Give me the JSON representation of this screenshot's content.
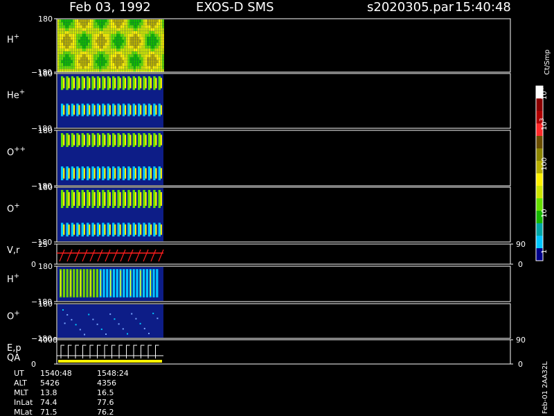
{
  "header": {
    "date": "Feb 03, 1992",
    "instrument": "EXOS-D SMS",
    "file": "s2020305.par",
    "time": "15:40:48"
  },
  "chart_data": {
    "type": "heatmap",
    "panels": [
      {
        "id": "hplus-top",
        "label_base": "H",
        "label_sup": "+",
        "ylim": [
          -180,
          180
        ],
        "ytick_top": "180",
        "ytick_bottom": "−180",
        "mode": "full",
        "bands": [
          {
            "start": 0.05,
            "end": 0.95
          }
        ]
      },
      {
        "id": "heplus",
        "label_base": "He",
        "label_sup": "+",
        "ylim": [
          -180,
          180
        ],
        "ytick_top": "180",
        "ytick_bottom": "−180",
        "mode": "bands",
        "bands": [
          {
            "start": 0.05,
            "end": 0.3
          },
          {
            "start": 0.55,
            "end": 0.78
          }
        ]
      },
      {
        "id": "oplusplus",
        "label_base": "O",
        "label_sup": "++",
        "ylim": [
          -180,
          180
        ],
        "ytick_top": "180",
        "ytick_bottom": "−180",
        "mode": "bands",
        "bands": [
          {
            "start": 0.05,
            "end": 0.3
          },
          {
            "start": 0.65,
            "end": 0.9
          }
        ]
      },
      {
        "id": "oplus-top",
        "label_base": "O",
        "label_sup": "+",
        "ylim": [
          -180,
          180
        ],
        "ytick_top": "180",
        "ytick_bottom": "−180",
        "mode": "bands",
        "bands": [
          {
            "start": 0.05,
            "end": 0.38
          },
          {
            "start": 0.65,
            "end": 0.9
          }
        ]
      },
      {
        "id": "vr",
        "label_base": "V,r",
        "label_sup": "",
        "ylim": [
          0,
          25
        ],
        "ytick_top": "25",
        "ytick_bottom": "0",
        "right_top": "90",
        "right_bottom": "0",
        "mode": "line"
      },
      {
        "id": "hplus-bottom",
        "label_base": "H",
        "label_sup": "+",
        "ylim": [
          -180,
          180
        ],
        "ytick_top": "180",
        "ytick_bottom": "−180",
        "mode": "stripes",
        "bands": [
          {
            "start": 0.08,
            "end": 0.88
          }
        ]
      },
      {
        "id": "oplus-bottom",
        "label_base": "O",
        "label_sup": "+",
        "ylim": [
          -180,
          180
        ],
        "ytick_top": "180",
        "ytick_bottom": "−180",
        "mode": "sparse",
        "bands": [
          {
            "start": 0.05,
            "end": 0.96
          }
        ]
      },
      {
        "id": "ep",
        "label_base": "E,p",
        "label_sup": "",
        "label2": "QA",
        "ylim": [
          0,
          4000
        ],
        "ytick_top": "4000",
        "ytick_bottom": "0",
        "right_top": "90",
        "right_bottom": "0",
        "mode": "ep"
      }
    ],
    "colorbar": {
      "title": "Ct/Smp",
      "labels": [
        "10",
        "100",
        "10",
        "10",
        "1"
      ],
      "label_sups": [
        "4",
        "",
        "3",
        "",
        ""
      ],
      "colors": [
        "#ffffff",
        "#8b0000",
        "#b00000",
        "#ff2a2a",
        "#6b4e00",
        "#8d8600",
        "#b8b000",
        "#fff200",
        "#cde600",
        "#66e000",
        "#15b800",
        "#00a6a6",
        "#00c7ff",
        "#00008b"
      ]
    },
    "footer": {
      "rows": [
        {
          "label": "UT",
          "v1": "1540:48",
          "v2": "1548:24"
        },
        {
          "label": "ALT",
          "v1": "5426",
          "v2": "4356"
        },
        {
          "label": "MLT",
          "v1": "13.8",
          "v2": "16.5"
        },
        {
          "label": "InLat",
          "v1": "74.4",
          "v2": "77.6"
        },
        {
          "label": "MLat",
          "v1": "71.5",
          "v2": "76.2"
        }
      ],
      "side_text": "Feb-01 2AA32L"
    }
  }
}
